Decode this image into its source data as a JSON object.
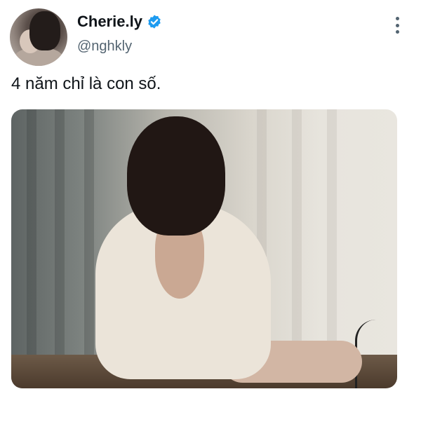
{
  "author": {
    "display_name": "Cherie.ly",
    "handle": "@nghkly",
    "verified": true,
    "avatar_icon": "profile-photo",
    "verified_color": "#1d9bf0"
  },
  "tweet": {
    "text": "4 năm chỉ là con số."
  },
  "media": {
    "type": "photo"
  },
  "icons": {
    "more": "more-options-icon"
  }
}
